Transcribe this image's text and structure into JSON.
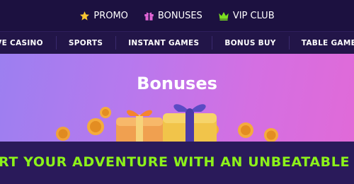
{
  "top_links": [
    {
      "label": "PROMO",
      "icon": "star-icon",
      "color": "#f7c531"
    },
    {
      "label": "BONUSES",
      "icon": "gift-icon",
      "color": "#e064d6"
    },
    {
      "label": "VIP CLUB",
      "icon": "crown-icon",
      "color": "#7ce020"
    }
  ],
  "nav": {
    "items": [
      "IVE CASINO",
      "SPORTS",
      "INSTANT GAMES",
      "BONUS BUY",
      "TABLE GAMES"
    ]
  },
  "hero": {
    "title": "Bonuses"
  },
  "banner": {
    "text": "RT YOUR ADVENTURE WITH AN UNBEATABLE WELCOM",
    "color": "#8cf21a"
  }
}
